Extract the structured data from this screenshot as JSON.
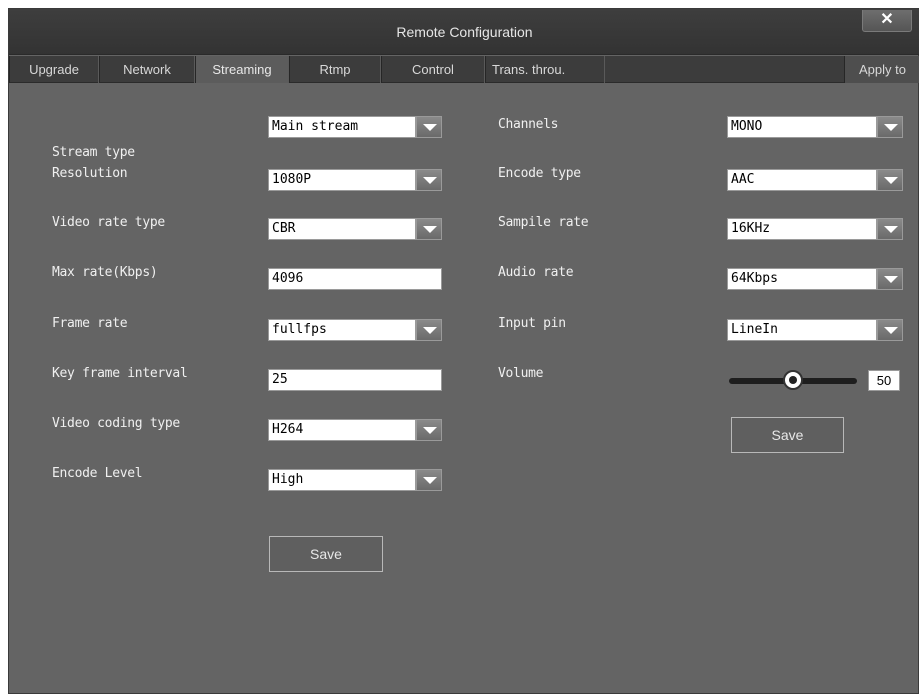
{
  "window": {
    "title": "Remote Configuration",
    "close_label": "✕"
  },
  "tabs": {
    "items": [
      "Upgrade",
      "Network",
      "Streaming",
      "Rtmp",
      "Control",
      "Trans. throu."
    ],
    "active": "Streaming",
    "apply": "Apply to"
  },
  "video": {
    "stream_type": {
      "label": "Stream type",
      "value": "Main stream"
    },
    "resolution": {
      "label": "Resolution",
      "value": "1080P"
    },
    "video_rate_type": {
      "label": "Video rate type",
      "value": "CBR"
    },
    "max_rate": {
      "label": "Max rate(Kbps)",
      "value": "4096"
    },
    "frame_rate": {
      "label": "Frame rate",
      "value": "fullfps"
    },
    "key_frame_interval": {
      "label": "Key frame interval",
      "value": "25"
    },
    "video_coding_type": {
      "label": "Video coding type",
      "value": "H264"
    },
    "encode_level": {
      "label": "Encode Level",
      "value": "High"
    },
    "save_label": "Save"
  },
  "audio": {
    "channels": {
      "label": "Channels",
      "value": "MONO"
    },
    "encode_type": {
      "label": "Encode type",
      "value": "AAC"
    },
    "sample_rate": {
      "label": "Sampile rate",
      "value": "16KHz"
    },
    "audio_rate": {
      "label": "Audio rate",
      "value": "64Kbps"
    },
    "input_pin": {
      "label": "Input pin",
      "value": "LineIn"
    },
    "volume": {
      "label": "Volume",
      "value": "50",
      "level_percent": 50
    },
    "save_label": "Save"
  }
}
